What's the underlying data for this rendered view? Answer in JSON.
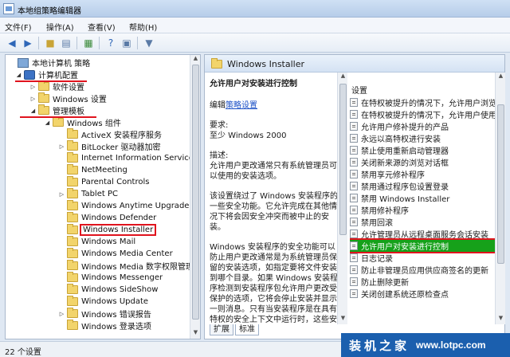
{
  "window": {
    "title": "本地组策略编辑器"
  },
  "menu": [
    "文件(F)",
    "操作(A)",
    "查看(V)",
    "帮助(H)"
  ],
  "toolbar_icons": [
    "back-arrow-icon",
    "forward-arrow-icon",
    "up-folder-icon",
    "show-hide-tree-icon",
    "export-list-icon",
    "help-icon",
    "properties-icon",
    "filter-icon"
  ],
  "tree": {
    "items": [
      {
        "label": "本地计算机 策略",
        "icon": "computer",
        "expander": ""
      },
      {
        "label": "计算机配置",
        "icon": "computer",
        "expander": "◢"
      },
      {
        "label": "软件设置",
        "icon": "folder",
        "expander": "▷"
      },
      {
        "label": "Windows 设置",
        "icon": "folder",
        "expander": "▷"
      },
      {
        "label": "管理模板",
        "icon": "folder",
        "expander": "◢"
      },
      {
        "label": "Windows 组件",
        "icon": "folder",
        "expander": "◢"
      },
      {
        "label": "ActiveX 安装程序服务",
        "icon": "folder",
        "expander": ""
      },
      {
        "label": "BitLocker 驱动器加密",
        "icon": "folder",
        "expander": "▷"
      },
      {
        "label": "Internet Information Services",
        "icon": "folder",
        "expander": ""
      },
      {
        "label": "NetMeeting",
        "icon": "folder",
        "expander": ""
      },
      {
        "label": "Parental Controls",
        "icon": "folder",
        "expander": ""
      },
      {
        "label": "Tablet PC",
        "icon": "folder",
        "expander": "▷"
      },
      {
        "label": "Windows Anytime Upgrade",
        "icon": "folder",
        "expander": ""
      },
      {
        "label": "Windows Defender",
        "icon": "folder",
        "expander": ""
      },
      {
        "label": "Windows Installer",
        "icon": "folder",
        "expander": ""
      },
      {
        "label": "Windows Mail",
        "icon": "folder",
        "expander": ""
      },
      {
        "label": "Windows Media Center",
        "icon": "folder",
        "expander": ""
      },
      {
        "label": "Windows Media 数字权限管理",
        "icon": "folder",
        "expander": ""
      },
      {
        "label": "Windows Messenger",
        "icon": "folder",
        "expander": ""
      },
      {
        "label": "Windows SideShow",
        "icon": "folder",
        "expander": ""
      },
      {
        "label": "Windows Update",
        "icon": "folder",
        "expander": ""
      },
      {
        "label": "Windows 错误报告",
        "icon": "folder",
        "expander": "▷"
      },
      {
        "label": "Windows 登录选项",
        "icon": "folder",
        "expander": ""
      }
    ],
    "selected": "Windows Installer"
  },
  "panel": {
    "header": "Windows Installer",
    "description": {
      "title": "允许用户对安装进行控制",
      "edit_prefix": "编辑",
      "edit_link": "策略设置",
      "requirements_label": "要求:",
      "requirements_value": "至少 Windows 2000",
      "desc_label": "描述:",
      "p1": "允许用户更改通常只有系统管理员可以使用的安装选项。",
      "p2": "该设置绕过了 Windows 安装程序的一些安全功能。它允许完成在其他情况下将会因安全冲突而被中止的安装。",
      "p3": "Windows 安装程序的安全功能可以防止用户更改通常是为系统管理员保留的安装选项，如指定要将文件安装到哪个目录。如果 Windows 安装程序检测到安装程序包允许用户更改受保护的选项，它将会停止安装并显示一则消息。只有当安装程序是在具有特权的安全上下文中运行时，这些安全功能才会起作用。"
    },
    "settings_header": "设置",
    "settings": [
      "在特权被提升的情况下，允许用户浏览",
      "在特权被提升的情况下，允许用户使用",
      "允许用户修补提升的产品",
      "永远以高特权进行安装",
      "禁止使用重新启动管理器",
      "关闭新来源的浏览对话框",
      "禁用享元修补程序",
      "禁用通过程序包设置登录",
      "禁用 Windows Installer",
      "禁用修补程序",
      "禁用回滚",
      "允许管理员从远程桌面服务会话安装",
      "允许用户对安装进行控制",
      "日志记录",
      "防止非管理员应用供应商签名的更新",
      "防止删除更新",
      "关闭创建系统还原检查点"
    ],
    "selected_setting": "允许用户对安装进行控制",
    "tabs": [
      "扩展",
      "标准"
    ],
    "active_tab": "标准"
  },
  "status": {
    "text": "22 个设置"
  },
  "watermark": {
    "cn": "装机之家",
    "url": "www.lotpc.com",
    "color": "#1b5fae"
  },
  "colors": {
    "highlight_red": "#e0141e",
    "selected_green": "#16a11a",
    "link_blue": "#1a4fc6"
  }
}
